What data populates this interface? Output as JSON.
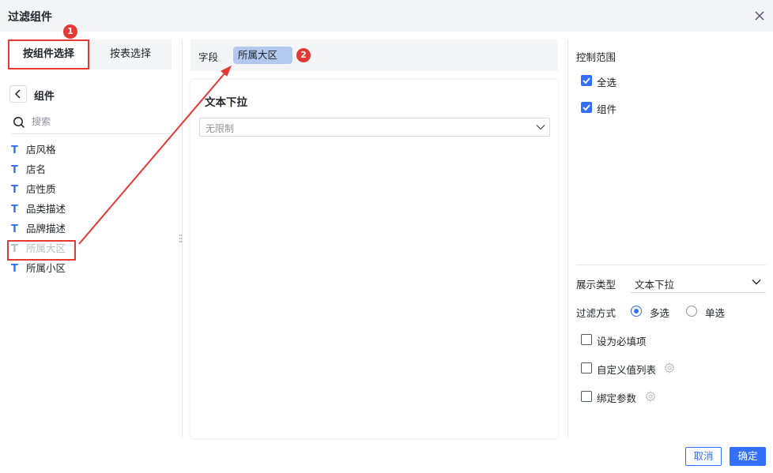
{
  "dialog": {
    "title": "过滤组件"
  },
  "tabs": [
    {
      "label": "按组件选择",
      "active": true
    },
    {
      "label": "按表选择",
      "active": false
    }
  ],
  "annotations": [
    "1",
    "2"
  ],
  "left": {
    "crumb_label": "组件",
    "search_placeholder": "搜索",
    "items": [
      {
        "label": "店风格",
        "disabled": false
      },
      {
        "label": "店名",
        "disabled": false
      },
      {
        "label": "店性质",
        "disabled": false
      },
      {
        "label": "品类描述",
        "disabled": false
      },
      {
        "label": "品牌描述",
        "disabled": false
      },
      {
        "label": "所属大区",
        "disabled": true
      },
      {
        "label": "所属小区",
        "disabled": false
      }
    ]
  },
  "middle": {
    "field_label": "字段",
    "field_chip": "所属大区",
    "card_title": "文本下拉",
    "select_value": "无限制"
  },
  "right": {
    "scope_title": "控制范围",
    "scope_options": [
      {
        "label": "全选",
        "checked": true
      },
      {
        "label": "组件",
        "checked": true
      }
    ],
    "display_type_label": "展示类型",
    "display_type_value": "文本下拉",
    "filter_mode_label": "过滤方式",
    "filter_modes": [
      {
        "label": "多选",
        "selected": true
      },
      {
        "label": "单选",
        "selected": false
      }
    ],
    "options": [
      {
        "label": "设为必填项",
        "checked": false,
        "has_gear": false
      },
      {
        "label": "自定义值列表",
        "checked": false,
        "has_gear": true
      },
      {
        "label": "绑定参数",
        "checked": false,
        "has_gear": true
      }
    ]
  },
  "footer": {
    "cancel_label": "取消",
    "ok_label": "确定"
  },
  "colors": {
    "accent": "#3370ff",
    "annotation": "#e53935",
    "chip": "#b4c9ef"
  }
}
